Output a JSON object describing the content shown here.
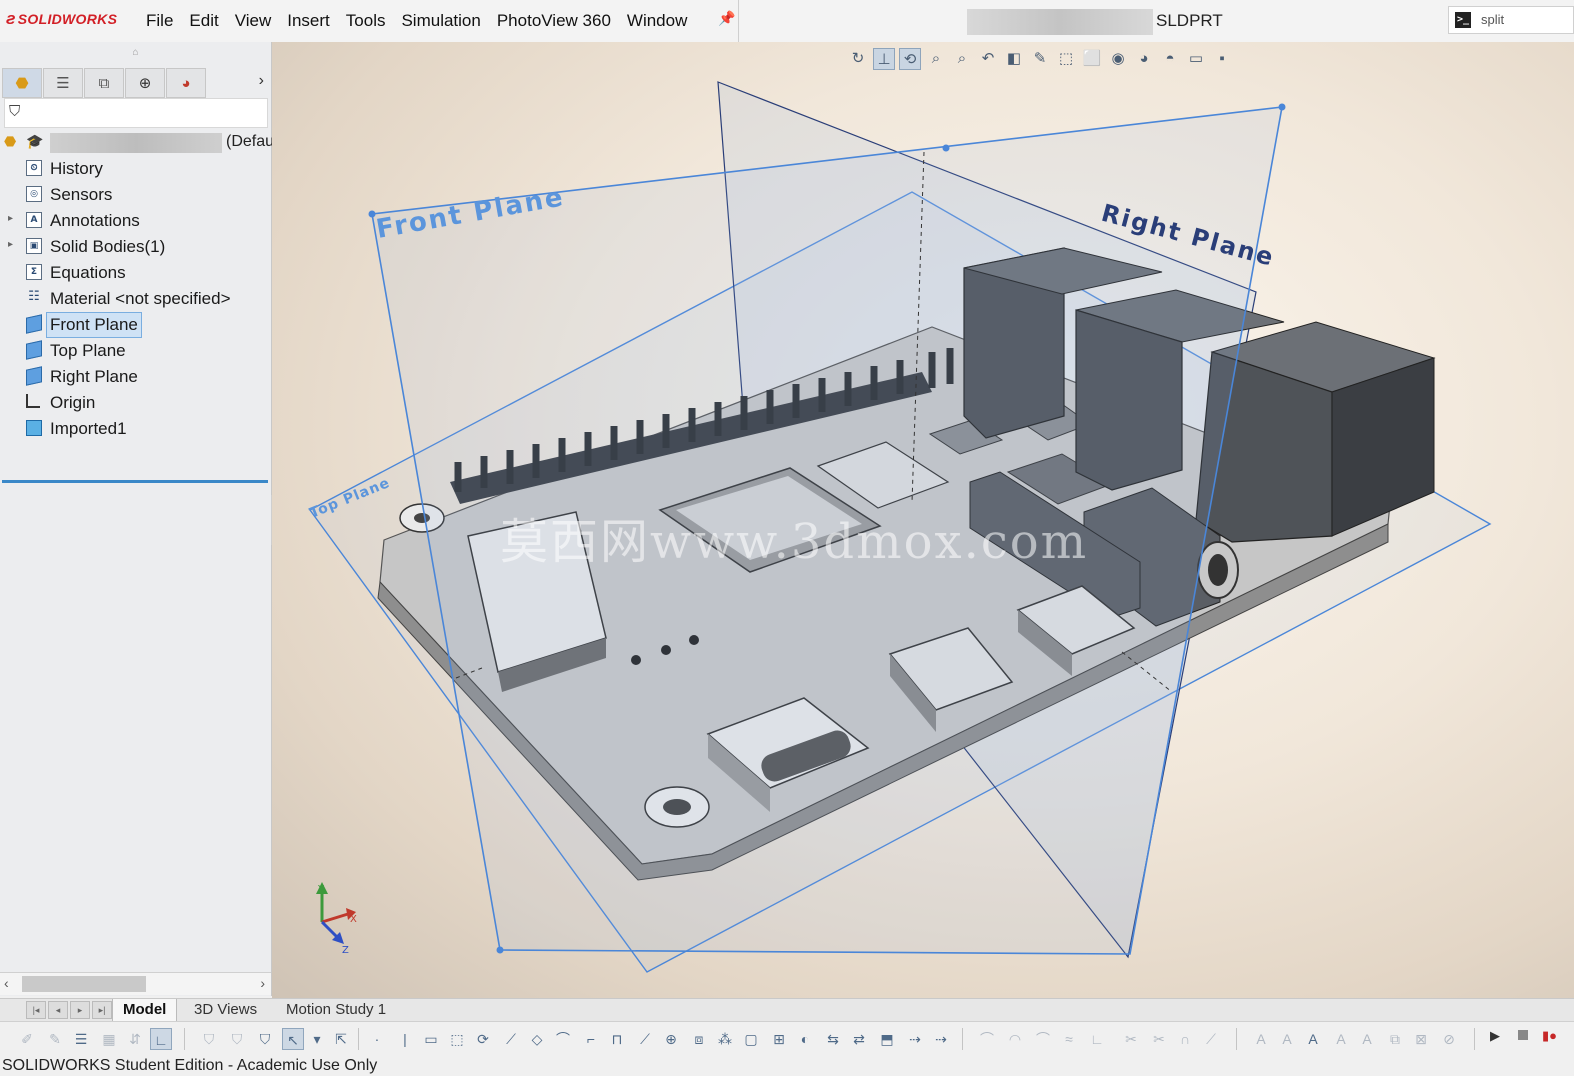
{
  "app": {
    "brand": "SOLIDWORKS",
    "menu": [
      "File",
      "Edit",
      "View",
      "Insert",
      "Tools",
      "Simulation",
      "PhotoView 360",
      "Window"
    ],
    "document_title": "SLDPRT",
    "search": {
      "value": "split"
    }
  },
  "feature_manager": {
    "tabs": [
      "feature-manager",
      "property-manager",
      "configuration-manager",
      "dimxpert-manager",
      "display-manager"
    ],
    "root_configuration": "(Defau",
    "items": [
      {
        "label": "History",
        "icon": "history-icon",
        "expandable": false
      },
      {
        "label": "Sensors",
        "icon": "sensors-icon",
        "expandable": false
      },
      {
        "label": "Annotations",
        "icon": "annotations-icon",
        "expandable": true
      },
      {
        "label": "Solid Bodies(1)",
        "icon": "solid-bodies-icon",
        "expandable": true
      },
      {
        "label": "Equations",
        "icon": "equations-icon",
        "expandable": false
      },
      {
        "label": "Material <not specified>",
        "icon": "material-icon",
        "expandable": false
      },
      {
        "label": "Front Plane",
        "icon": "plane-icon",
        "expandable": false,
        "selected": true
      },
      {
        "label": "Top Plane",
        "icon": "plane-icon",
        "expandable": false
      },
      {
        "label": "Right Plane",
        "icon": "plane-icon",
        "expandable": false
      },
      {
        "label": "Origin",
        "icon": "origin-icon",
        "expandable": false
      },
      {
        "label": "Imported1",
        "icon": "imported-body-icon",
        "expandable": false
      }
    ]
  },
  "viewport": {
    "plane_labels": {
      "front": "Front Plane",
      "right": "Right Plane",
      "top": "Top Plane"
    },
    "watermark": "莫西网www.3dmox.com",
    "triad": {
      "x": "X",
      "y": "Y",
      "z": "Z"
    },
    "colors": {
      "plane_edge": "#4a86d8",
      "right_plane_edge": "#2a3e78",
      "board": "#b8b8b8",
      "component": "#4f5358"
    }
  },
  "bottom_tabs": [
    "Model",
    "3D Views",
    "Motion Study 1"
  ],
  "active_bottom_tab": "Model",
  "status_bar": "SOLIDWORKS Student Edition - Academic Use Only"
}
